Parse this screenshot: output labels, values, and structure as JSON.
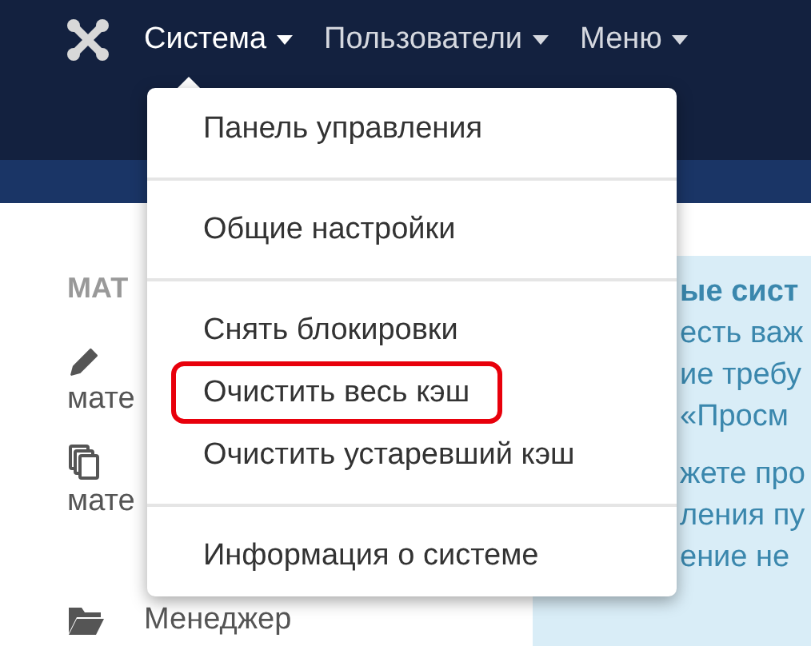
{
  "navbar": {
    "items": [
      {
        "label": "Система",
        "selected": true
      },
      {
        "label": "Пользователи",
        "selected": false
      },
      {
        "label": "Меню",
        "selected": false
      }
    ]
  },
  "sidebar": {
    "heading": "МАТ",
    "items": [
      {
        "kind": "pencil",
        "sublabel": "мате"
      },
      {
        "kind": "copy",
        "sublabel": "мате"
      },
      {
        "kind": "folder",
        "label": "Менеджер"
      }
    ]
  },
  "notice": {
    "title": "ые сист",
    "lines": [
      "есть важ",
      "ие требу",
      " «Просм"
    ],
    "lines_2": [
      "жете про",
      "ления пу",
      "ение не"
    ]
  },
  "dropdown": {
    "groups": [
      [
        {
          "label": "Панель управления",
          "highlighted": false
        }
      ],
      [
        {
          "label": "Общие настройки",
          "highlighted": false
        }
      ],
      [
        {
          "label": "Снять блокировки",
          "highlighted": false
        },
        {
          "label": "Очистить весь кэш",
          "highlighted": true
        },
        {
          "label": "Очистить устаревший кэш",
          "highlighted": false
        }
      ],
      [
        {
          "label": "Информация о системе",
          "highlighted": false
        }
      ]
    ]
  }
}
